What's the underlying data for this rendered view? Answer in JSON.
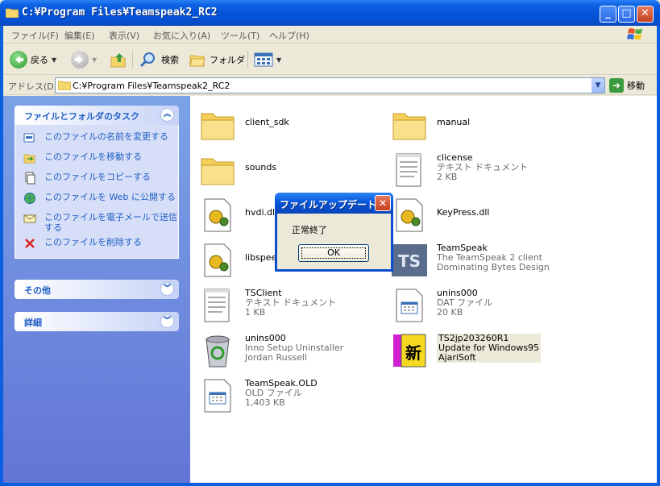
{
  "window": {
    "title": "C:¥Program Files¥Teamspeak2_RC2",
    "minimize": "_",
    "maximize": "□",
    "close": "✕"
  },
  "menu": [
    "ファイル(F)",
    "編集(E)",
    "表示(V)",
    "お気に入り(A)",
    "ツール(T)",
    "ヘルプ(H)"
  ],
  "toolbar": {
    "back_label": "戻る",
    "search_label": "検索",
    "folder_label": "フォルダ"
  },
  "address": {
    "label": "アドレス(D)",
    "value": "C:¥Program Files¥Teamspeak2_RC2",
    "go_label": "移動"
  },
  "left_panel": {
    "tasks_title": "ファイルとフォルダのタスク",
    "tasks": [
      {
        "label": "このファイルの名前を変更する",
        "icon": "rename-icon"
      },
      {
        "label": "このファイルを移動する",
        "icon": "move-icon"
      },
      {
        "label": "このファイルをコピーする",
        "icon": "copy-icon"
      },
      {
        "label": "このファイルを Web に公開する",
        "icon": "publish-web-icon"
      },
      {
        "label": "このファイルを電子メールで送信する",
        "icon": "email-icon"
      },
      {
        "label": "このファイルを削除する",
        "icon": "delete-icon"
      }
    ],
    "other_title": "その他",
    "details_title": "詳細"
  },
  "files": [
    {
      "name": "client_sdk",
      "type": "folder"
    },
    {
      "name": "manual",
      "type": "folder"
    },
    {
      "name": "sounds",
      "type": "folder"
    },
    {
      "name": "clicense",
      "line2": "テキスト ドキュメント",
      "line3": "2 KB",
      "type": "text"
    },
    {
      "name": "hvdi.dll",
      "type": "dll"
    },
    {
      "name": "KeyPress.dll",
      "type": "dll"
    },
    {
      "name": "libspeex.dll",
      "type": "dll"
    },
    {
      "name": "TeamSpeak",
      "line2": "The TeamSpeak 2 client",
      "line3": "Dominating Bytes Design",
      "type": "ts"
    },
    {
      "name": "TSClient",
      "line2": "テキスト ドキュメント",
      "line3": "1 KB",
      "type": "text"
    },
    {
      "name": "unins000",
      "line2": "DAT ファイル",
      "line3": "20 KB",
      "type": "dat"
    },
    {
      "name": "unins000",
      "line2": "Inno Setup Uninstaller",
      "line3": "Jordan Russell",
      "type": "uninstaller"
    },
    {
      "name": "TS2jp203260R1",
      "line2": "Update for Windows95",
      "line3": "AjariSoft",
      "type": "update"
    },
    {
      "name": "TeamSpeak.OLD",
      "line2": "OLD ファイル",
      "line3": "1,403 KB",
      "type": "dat"
    }
  ],
  "dialog": {
    "title": "ファイルアップデート",
    "message": "正常終了",
    "ok_label": "OK"
  }
}
